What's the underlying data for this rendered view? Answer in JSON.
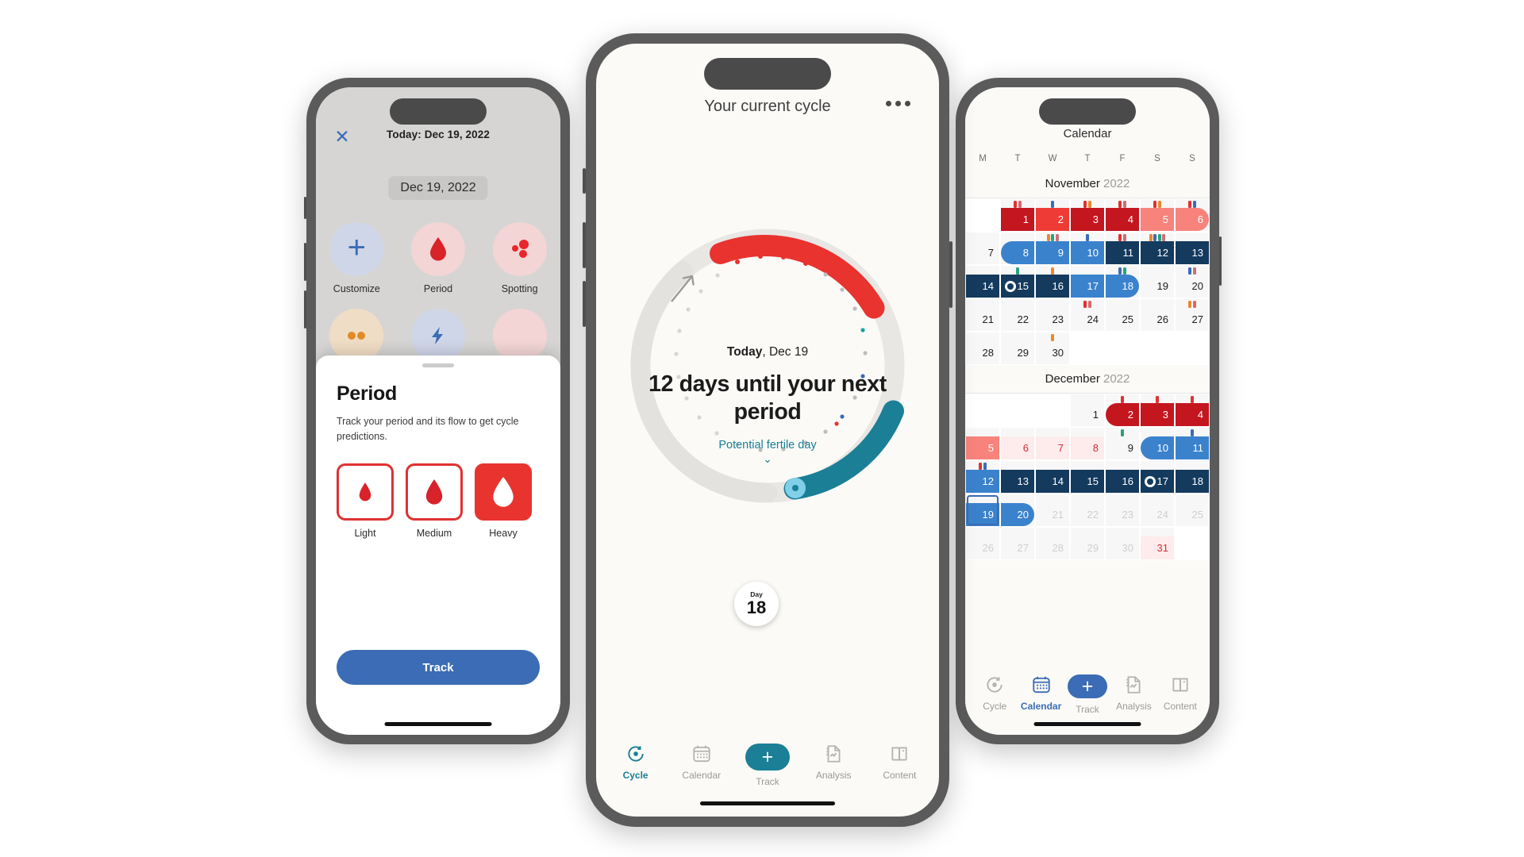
{
  "left_phone": {
    "close_icon": "close-icon",
    "today_label": "Today: Dec 19, 2022",
    "date_pill": "Dec 19, 2022",
    "quick_items": [
      {
        "label": "Customize",
        "icon": "plus-icon"
      },
      {
        "label": "Period",
        "icon": "blood-drop-icon"
      },
      {
        "label": "Spotting",
        "icon": "spotting-dots-icon"
      }
    ],
    "sheet": {
      "title": "Period",
      "description": "Track your period and its flow to get cycle predictions.",
      "flow_options": [
        {
          "label": "Light",
          "selected": false
        },
        {
          "label": "Medium",
          "selected": false
        },
        {
          "label": "Heavy",
          "selected": true
        }
      ],
      "track_button": "Track"
    }
  },
  "center_phone": {
    "header_title": "Your current cycle",
    "more_icon": "more-horizontal-icon",
    "today_prefix": "Today",
    "today_date": ", Dec 19",
    "headline": "12 days until your next period",
    "fertile_link": "Potential fertile day",
    "chevron_icon": "chevron-down-icon",
    "day_marker": {
      "label": "Day",
      "number": "18"
    },
    "nav": [
      {
        "label": "Cycle",
        "icon": "cycle-icon",
        "active": true
      },
      {
        "label": "Calendar",
        "icon": "calendar-icon",
        "active": false
      },
      {
        "label": "Track",
        "icon": "plus-icon",
        "fab": true
      },
      {
        "label": "Analysis",
        "icon": "analysis-icon",
        "active": false
      },
      {
        "label": "Content",
        "icon": "content-book-icon",
        "active": false
      }
    ]
  },
  "right_phone": {
    "title": "Calendar",
    "dow": [
      "T",
      "W",
      "T",
      "F",
      "S",
      "S"
    ],
    "months": [
      {
        "name": "November",
        "year": "2022",
        "weeks": [
          [
            {
              "n": "",
              "blank": true
            },
            {
              "n": "1",
              "style": "period-dark",
              "dots": [
                "#e03131",
                "#d9686e"
              ]
            },
            {
              "n": "2",
              "style": "period-mid",
              "dots": [
                "#3b6cb5"
              ]
            },
            {
              "n": "3",
              "style": "period-dark",
              "dots": [
                "#e03131",
                "#e8882f"
              ]
            },
            {
              "n": "4",
              "style": "period-dark",
              "dots": [
                "#e03131",
                "#c96f78"
              ]
            },
            {
              "n": "5",
              "style": "period-light",
              "dots": [
                "#e03131",
                "#e8882f"
              ]
            },
            {
              "n": "6",
              "style": "period-light-end",
              "dots": [
                "#e03131",
                "#3b6cb5"
              ]
            }
          ],
          [
            {
              "n": "7",
              "style": "plain"
            },
            {
              "n": "8",
              "style": "fertile-start",
              "dots": []
            },
            {
              "n": "9",
              "style": "fertile",
              "dots": [
                "#e8882f",
                "#2aa181",
                "#c96f78"
              ]
            },
            {
              "n": "10",
              "style": "fertile",
              "dots": [
                "#3b6cb5"
              ]
            },
            {
              "n": "11",
              "style": "ovul-dark",
              "dots": [
                "#e03131",
                "#c96f78"
              ]
            },
            {
              "n": "12",
              "style": "ovul-dark",
              "dots": [
                "#e8882f",
                "#3b6cb5",
                "#2aa181",
                "#c96f78"
              ]
            },
            {
              "n": "13",
              "style": "ovul-dark",
              "dots": []
            }
          ],
          [
            {
              "n": "14",
              "style": "ovul-dark"
            },
            {
              "n": "15",
              "style": "ovul-dark",
              "moon": true,
              "dots": [
                "#2aa181"
              ]
            },
            {
              "n": "16",
              "style": "ovul-dark",
              "dots": [
                "#e8882f"
              ]
            },
            {
              "n": "17",
              "style": "fertile",
              "dots": []
            },
            {
              "n": "18",
              "style": "fertile-end",
              "dots": [
                "#3b6cb5",
                "#2aa181"
              ]
            },
            {
              "n": "19",
              "style": "plain",
              "dots": []
            },
            {
              "n": "20",
              "style": "plain",
              "dots": [
                "#3b6cb5",
                "#c96f78"
              ]
            }
          ],
          [
            {
              "n": "21",
              "style": "plain"
            },
            {
              "n": "22",
              "style": "plain"
            },
            {
              "n": "23",
              "style": "plain"
            },
            {
              "n": "24",
              "style": "plain",
              "dots": [
                "#e03131",
                "#d9686e"
              ]
            },
            {
              "n": "25",
              "style": "plain"
            },
            {
              "n": "26",
              "style": "plain"
            },
            {
              "n": "27",
              "style": "plain",
              "dots": [
                "#e8882f",
                "#d9686e"
              ]
            }
          ],
          [
            {
              "n": "28",
              "style": "plain"
            },
            {
              "n": "29",
              "style": "plain"
            },
            {
              "n": "30",
              "style": "plain",
              "dots": [
                "#e8882f"
              ]
            },
            {
              "n": "",
              "blank": true
            },
            {
              "n": "",
              "blank": true
            },
            {
              "n": "",
              "blank": true
            },
            {
              "n": "",
              "blank": true
            }
          ]
        ]
      },
      {
        "name": "December",
        "year": "2022",
        "weeks": [
          [
            {
              "n": "",
              "blank": true
            },
            {
              "n": "",
              "blank": true
            },
            {
              "n": "",
              "blank": true
            },
            {
              "n": "1",
              "style": "plain"
            },
            {
              "n": "2",
              "style": "period-start",
              "dots": [
                "#e03131"
              ]
            },
            {
              "n": "3",
              "style": "period-dark",
              "dots": [
                "#e03131"
              ]
            },
            {
              "n": "4",
              "style": "period-dark",
              "dots": [
                "#e03131"
              ]
            }
          ],
          [
            {
              "n": "5",
              "style": "period-light"
            },
            {
              "n": "6",
              "style": "pred",
              "dots": []
            },
            {
              "n": "7",
              "style": "pred"
            },
            {
              "n": "8",
              "style": "pred"
            },
            {
              "n": "9",
              "style": "plain",
              "dots": [
                "#2aa181"
              ]
            },
            {
              "n": "10",
              "style": "fertile-start"
            },
            {
              "n": "11",
              "style": "fertile",
              "dots": [
                "#3b6cb5"
              ]
            }
          ],
          [
            {
              "n": "12",
              "style": "fertile",
              "dots": [
                "#e03131",
                "#3b6cb5"
              ]
            },
            {
              "n": "13",
              "style": "ovul-dark"
            },
            {
              "n": "14",
              "style": "ovul-dark"
            },
            {
              "n": "15",
              "style": "ovul-dark"
            },
            {
              "n": "16",
              "style": "ovul-dark"
            },
            {
              "n": "17",
              "style": "ovul-dark",
              "moon": true
            },
            {
              "n": "18",
              "style": "ovul-dark"
            }
          ],
          [
            {
              "n": "19",
              "style": "fertile",
              "selected": true
            },
            {
              "n": "20",
              "style": "fertile-end"
            },
            {
              "n": "21",
              "style": "future"
            },
            {
              "n": "22",
              "style": "future"
            },
            {
              "n": "23",
              "style": "future"
            },
            {
              "n": "24",
              "style": "future"
            },
            {
              "n": "25",
              "style": "future"
            }
          ],
          [
            {
              "n": "26",
              "style": "future"
            },
            {
              "n": "27",
              "style": "future"
            },
            {
              "n": "28",
              "style": "future"
            },
            {
              "n": "29",
              "style": "future"
            },
            {
              "n": "30",
              "style": "future"
            },
            {
              "n": "31",
              "style": "pred-red"
            },
            {
              "n": "",
              "blank": true
            }
          ]
        ]
      }
    ],
    "nav": [
      {
        "label": "Cycle",
        "icon": "cycle-icon",
        "active": false
      },
      {
        "label": "Calendar",
        "icon": "calendar-icon",
        "active": true
      },
      {
        "label": "Track",
        "icon": "plus-icon",
        "fab": true
      },
      {
        "label": "Analysis",
        "icon": "analysis-icon",
        "active": false
      },
      {
        "label": "Content",
        "icon": "content-book-icon",
        "active": false
      }
    ]
  },
  "colors": {
    "period_red": "#c4161f",
    "period_bright": "#e8332f",
    "period_light": "#f7837c",
    "fertile_blue": "#3b82cd",
    "ovulation_navy": "#143a5e",
    "teal": "#1b7f96",
    "button_blue": "#3b6cb5"
  }
}
